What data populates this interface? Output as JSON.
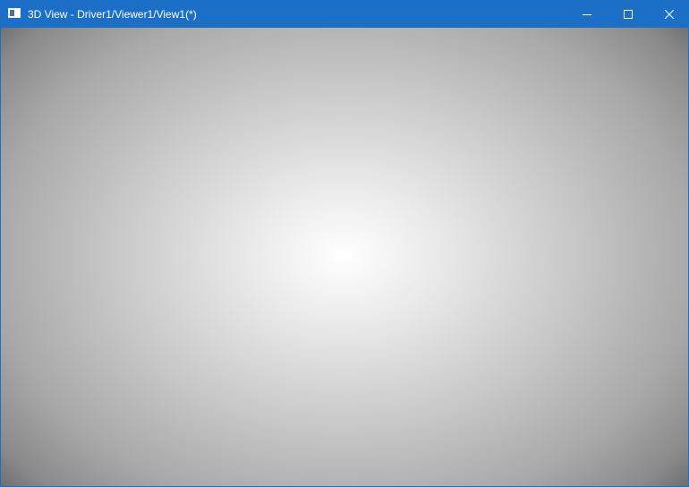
{
  "window": {
    "title": "3D View - Driver1/Viewer1/View1(*)",
    "accent_color": "#1c6fc7"
  },
  "titlebar_controls": {
    "minimize_icon": "minimize-icon",
    "maximize_icon": "maximize-icon",
    "close_icon": "close-icon"
  },
  "viewport": {
    "background": "radial gradient white center to dark gray corners"
  }
}
